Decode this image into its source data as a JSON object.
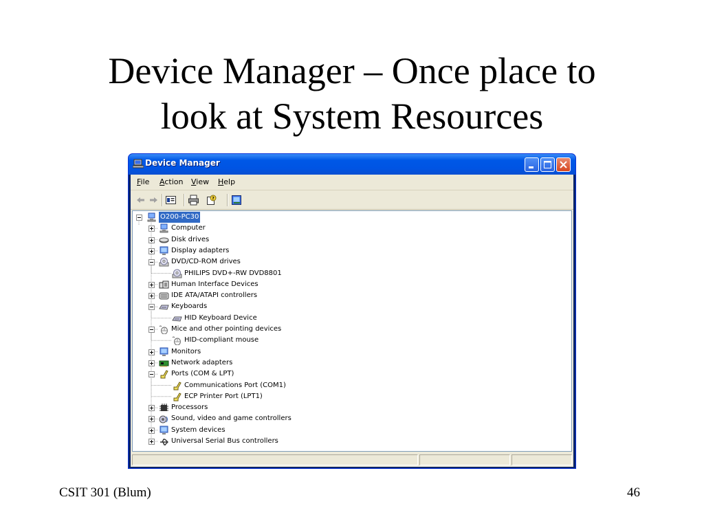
{
  "slide": {
    "title_line1": "Device Manager – Once place to",
    "title_line2": "look at System Resources",
    "footer_left": "CSIT 301 (Blum)",
    "page_number": "46"
  },
  "window": {
    "title": "Device Manager",
    "controls": [
      "minimize",
      "maximize",
      "close"
    ],
    "colors": {
      "titlebar": "#0054e3",
      "close": "#d6461f",
      "face": "#ece9d8",
      "selection": "#316ac5"
    }
  },
  "menubar": {
    "file": "File",
    "action": "Action",
    "view": "View",
    "help": "Help"
  },
  "toolbar": {
    "icons": [
      "back-arrow-icon",
      "forward-arrow-icon",
      "properties-icon",
      "print-icon",
      "help-icon",
      "scan-hardware-icon"
    ]
  },
  "tree": {
    "root": "O200-PC30",
    "items": [
      {
        "label": "Computer",
        "icon": "computer-icon",
        "expanded": false
      },
      {
        "label": "Disk drives",
        "icon": "disk-drive-icon",
        "expanded": false
      },
      {
        "label": "Display adapters",
        "icon": "display-adapter-icon",
        "expanded": false
      },
      {
        "label": "DVD/CD-ROM drives",
        "icon": "cdrom-icon",
        "expanded": true
      },
      {
        "label": "PHILIPS DVD+-RW DVD8801",
        "icon": "cdrom-icon",
        "child": true
      },
      {
        "label": "Human Interface Devices",
        "icon": "hid-icon",
        "expanded": false
      },
      {
        "label": "IDE ATA/ATAPI controllers",
        "icon": "ide-controller-icon",
        "expanded": false
      },
      {
        "label": "Keyboards",
        "icon": "keyboard-icon",
        "expanded": true
      },
      {
        "label": "HID Keyboard Device",
        "icon": "keyboard-icon",
        "child": true
      },
      {
        "label": "Mice and other pointing devices",
        "icon": "mouse-icon",
        "expanded": true
      },
      {
        "label": "HID-compliant mouse",
        "icon": "mouse-icon",
        "child": true
      },
      {
        "label": "Monitors",
        "icon": "monitor-icon",
        "expanded": false
      },
      {
        "label": "Network adapters",
        "icon": "network-adapter-icon",
        "expanded": false
      },
      {
        "label": "Ports (COM & LPT)",
        "icon": "port-icon",
        "expanded": true
      },
      {
        "label": "Communications Port (COM1)",
        "icon": "port-icon",
        "child": true
      },
      {
        "label": "ECP Printer Port (LPT1)",
        "icon": "port-icon",
        "child": true
      },
      {
        "label": "Processors",
        "icon": "processor-icon",
        "expanded": false
      },
      {
        "label": "Sound, video and game controllers",
        "icon": "sound-icon",
        "expanded": false
      },
      {
        "label": "System devices",
        "icon": "system-device-icon",
        "expanded": false
      },
      {
        "label": "Universal Serial Bus controllers",
        "icon": "usb-icon",
        "expanded": false
      }
    ]
  }
}
